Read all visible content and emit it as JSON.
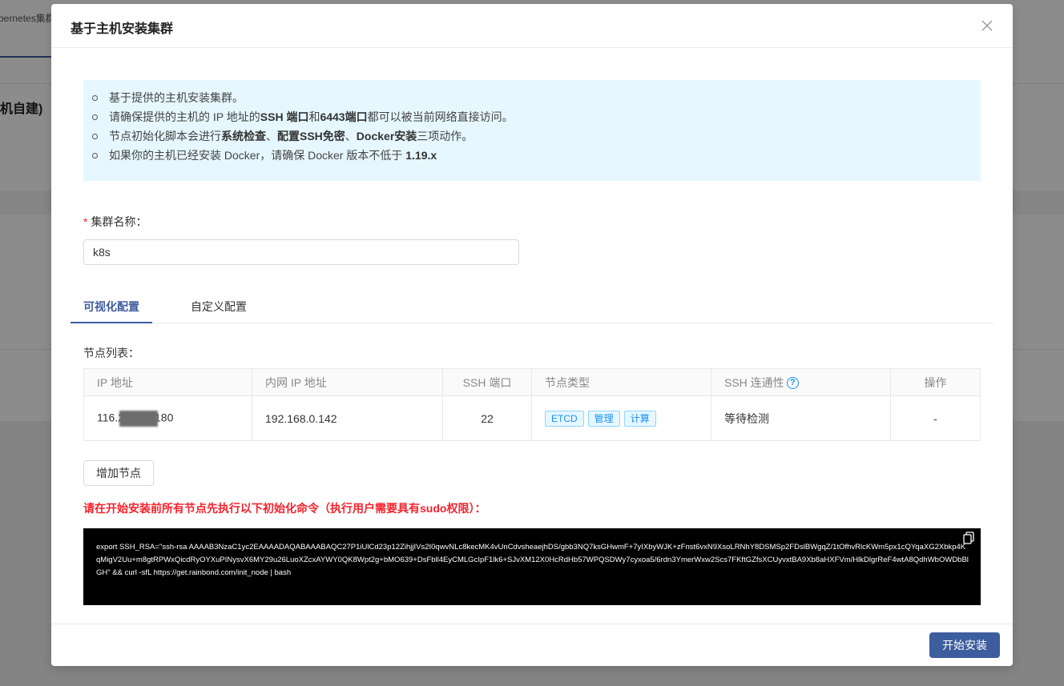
{
  "background": {
    "tab_text": "bernetes集群",
    "page_title": "机自建)"
  },
  "modal": {
    "title": "基于主机安装集群",
    "close_label": "X",
    "notice": [
      {
        "parts": [
          {
            "t": "基于提供的主机安装集群。",
            "b": false
          }
        ]
      },
      {
        "parts": [
          {
            "t": "请确保提供的主机的 IP 地址的",
            "b": false
          },
          {
            "t": "SSH 端口",
            "b": true
          },
          {
            "t": "和",
            "b": false
          },
          {
            "t": "6443端口",
            "b": true
          },
          {
            "t": "都可以被当前网络直接访问。",
            "b": false
          }
        ]
      },
      {
        "parts": [
          {
            "t": "节点初始化脚本会进行",
            "b": false
          },
          {
            "t": "系统检查",
            "b": true
          },
          {
            "t": "、",
            "b": false
          },
          {
            "t": "配置SSH免密",
            "b": true
          },
          {
            "t": "、",
            "b": false
          },
          {
            "t": "Docker安装",
            "b": true
          },
          {
            "t": "三项动作。",
            "b": false
          }
        ]
      },
      {
        "parts": [
          {
            "t": "如果你的主机已经安装 Docker，请确保 Docker 版本不低于 ",
            "b": false
          },
          {
            "t": "1.19.x",
            "b": true
          }
        ]
      }
    ],
    "cluster_name_label": "集群名称：",
    "cluster_name_required": "*",
    "cluster_name_value": "k8s",
    "tabs": [
      {
        "label": "可视化配置",
        "active": true
      },
      {
        "label": "自定义配置",
        "active": false
      }
    ],
    "node_list_label": "节点列表：",
    "table": {
      "headers": [
        "IP 地址",
        "内网 IP 地址",
        "SSH 端口",
        "节点类型",
        "SSH 连通性",
        "操作"
      ],
      "rows": [
        {
          "ip_prefix": "116.2",
          "ip_suffix": "180",
          "inner_ip": "192.168.0.142",
          "ssh_port": "22",
          "node_types": [
            "ETCD",
            "管理",
            "计算"
          ],
          "ssh_status": "等待检测",
          "action": "-"
        }
      ]
    },
    "add_node_label": "增加节点",
    "warning": "请在开始安装前所有节点先执行以下初始化命令（执行用户需要具有sudo权限）：",
    "command": "export SSH_RSA=\"ssh-rsa AAAAB3NzaC1yc2EAAAADAQABAAABAQC27P1iUlCd23p12ZihjjIVs2I0qwvNLc8kecMK4vUnCdvsheaejhDS/gbb3NQ7ksGHwmF+7yIXbyWJK+zFnst6vxN9XsoLRNhY8DSMSp2FDslBWgqZ/1tOfhvRlcKWm5px1cQYqaXG2Xbkp4KqMigV2Uu+m8gtRPWxQicdRyOYXuPINysvX6MY29u26LuoXZcxAYWY0QK8Wpt2g+bMO639+DsFbll4EyCMLGcIpF1lk6+SJvXM12X0HcRdHb57WPQSDWy7cyxoa5/6rdn3YmerWxw2Scs7FKftGZfsXCUyvxtBA9Xb8aHXFVm/HlkDlgrReF4wtA8QdhWbOWDbBlGH\" && curl -sfL https://get.rainbond.com/init_node | bash",
    "install_label": "开始安装"
  }
}
